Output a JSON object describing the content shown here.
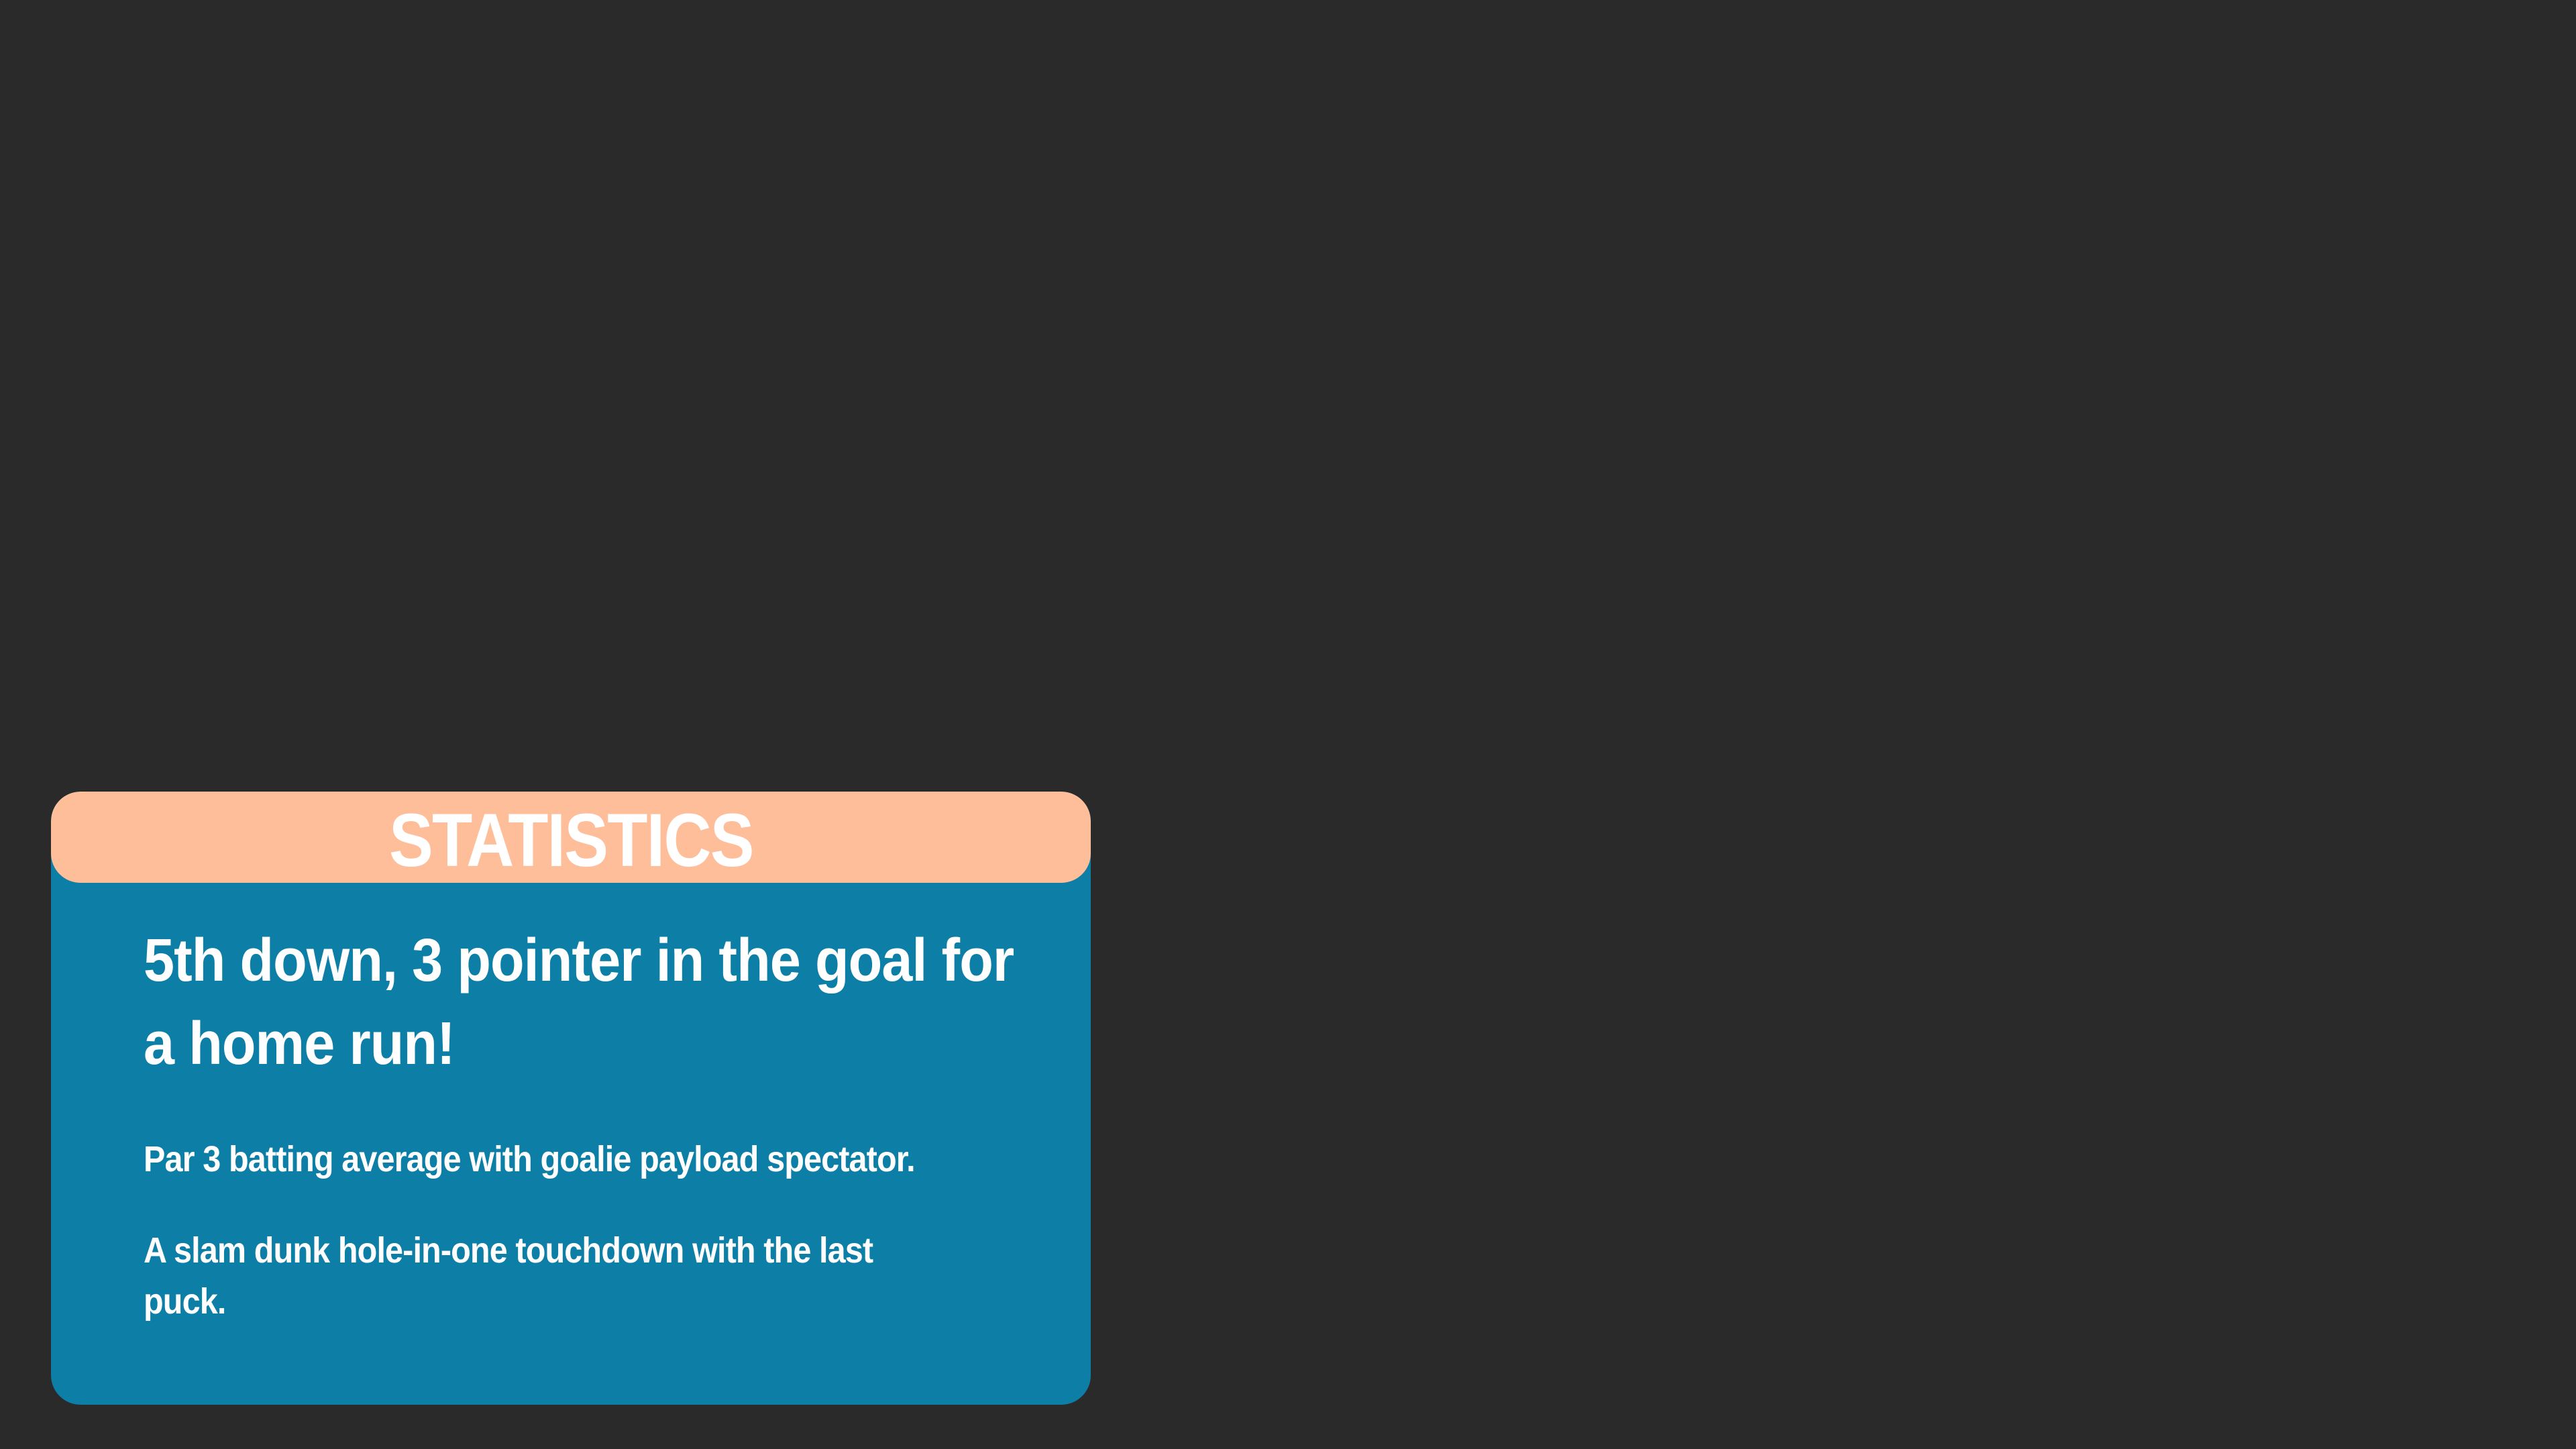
{
  "card": {
    "title": "STATISTICS",
    "headline": "5th down, 3 pointer in the goal for a home run!",
    "paragraphs": [
      "Par 3 batting average with goalie payload spectator.",
      "A slam dunk hole-in-one touchdown with the last puck."
    ]
  },
  "colors": {
    "background": "#2a2a2a",
    "card": "#0d7fa6",
    "header": "#ffbe9a",
    "text": "#ffffff"
  }
}
